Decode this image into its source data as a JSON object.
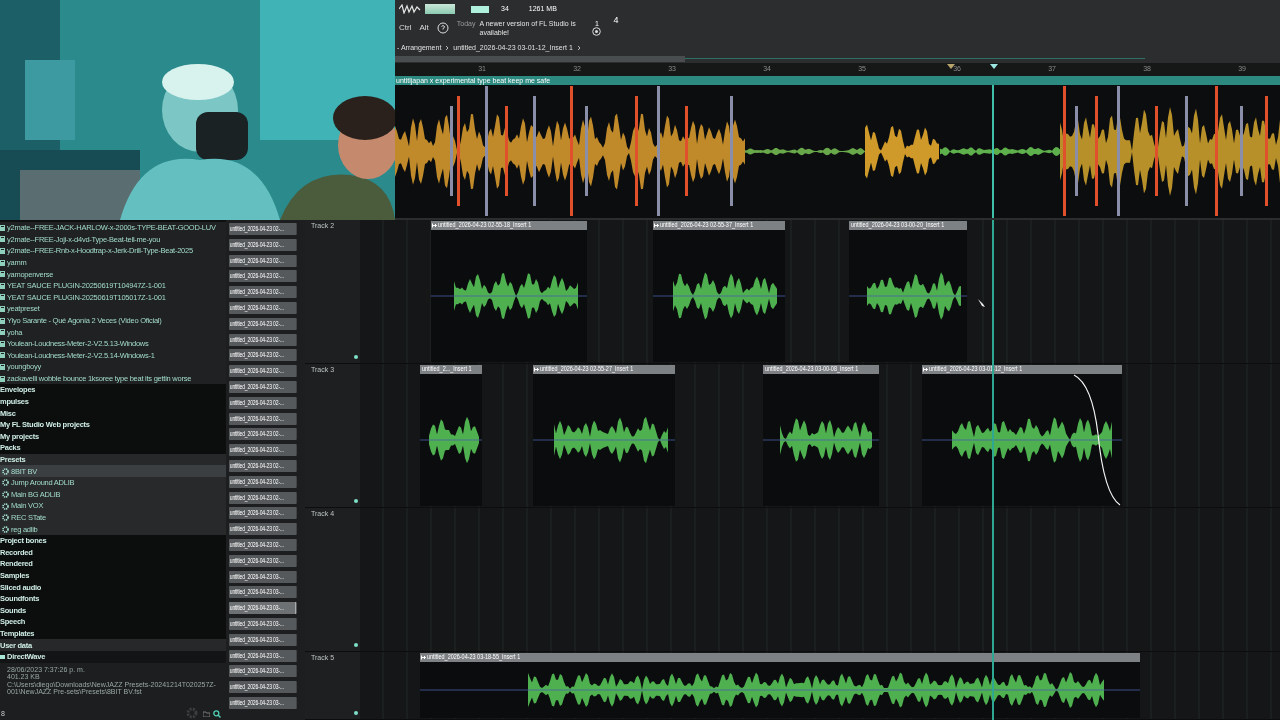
{
  "toolbar": {
    "cpu": "34",
    "memory": "1261 MB",
    "voices": "4",
    "keys": [
      "Ctrl",
      "Alt"
    ],
    "hint_day": "Today",
    "hint": "A newer version of FL Studio is available!",
    "hint_count": "1"
  },
  "breadcrumb": [
    "- Arrangement",
    "untitled_2026-04-23 03-01-12_Insert 1"
  ],
  "ruler": [
    "31",
    "32",
    "33",
    "34",
    "35",
    "36",
    "37",
    "38",
    "39"
  ],
  "browser": {
    "items": [
      {
        "label": "y2mate--FREE-JACK-HARLOW-x-2000s-TYPE-BEAT-GOOD-LUV",
        "kind": "file",
        "selected": false
      },
      {
        "label": "y2mate--FREE-Joji-x-d4vd-Type-Beat-tell-me-you",
        "kind": "file",
        "selected": false
      },
      {
        "label": "y2mate--FREE-Rnb-x-Hoodtrap-x-Jerk-Drill-Type-Beat-2025",
        "kind": "file",
        "selected": false
      },
      {
        "label": "yamm",
        "kind": "file",
        "selected": false
      },
      {
        "label": "yamopenverse",
        "kind": "file",
        "selected": false
      },
      {
        "label": "YEAT SAUCE PLUGIN-20250619T104947Z-1-001",
        "kind": "file",
        "selected": false
      },
      {
        "label": "YEAT SAUCE PLUGIN-20250619T105017Z-1-001",
        "kind": "file",
        "selected": false
      },
      {
        "label": "yeatpreset",
        "kind": "file",
        "selected": false
      },
      {
        "label": "Yiyo Sarante -  Qué Agonía  2 Veces (Video Oficial)",
        "kind": "file",
        "selected": false
      },
      {
        "label": "yoha",
        "kind": "file",
        "selected": false
      },
      {
        "label": "Youlean-Loudness-Meter-2-V2.5.13-Windows",
        "kind": "file",
        "selected": false
      },
      {
        "label": "Youlean-Loudness-Meter-2-V2.5.14-Windows-1",
        "kind": "file",
        "selected": false
      },
      {
        "label": "youngboyy",
        "kind": "file",
        "selected": false
      },
      {
        "label": "zackavelli  wobble  bounce  1ksoree type beat its gettin worse",
        "kind": "file",
        "selected": false
      },
      {
        "label": "Envelopes",
        "kind": "folder",
        "selected": false
      },
      {
        "label": "mpulses",
        "kind": "folder",
        "selected": false
      },
      {
        "label": "Misc",
        "kind": "folder",
        "selected": false
      },
      {
        "label": "My FL Studio Web projects",
        "kind": "folder",
        "selected": false
      },
      {
        "label": "My projects",
        "kind": "folder",
        "selected": false
      },
      {
        "label": "Packs",
        "kind": "folder",
        "selected": false
      },
      {
        "label": "Presets",
        "kind": "heading",
        "selected": false
      },
      {
        "label": "8BIT BV",
        "kind": "preset",
        "selected": true
      },
      {
        "label": "Jump Around ADLIB",
        "kind": "preset",
        "selected": false
      },
      {
        "label": "Main BG ADLIB",
        "kind": "preset",
        "selected": false
      },
      {
        "label": "Main VOX",
        "kind": "preset",
        "selected": false
      },
      {
        "label": "REC STate",
        "kind": "preset",
        "selected": false
      },
      {
        "label": "reg adlib",
        "kind": "preset",
        "selected": false
      },
      {
        "label": "Project bones",
        "kind": "folder",
        "selected": false
      },
      {
        "label": "Recorded",
        "kind": "folder",
        "selected": false
      },
      {
        "label": "Rendered",
        "kind": "folder",
        "selected": false
      },
      {
        "label": "Samples",
        "kind": "folder",
        "selected": false
      },
      {
        "label": "Sliced audio",
        "kind": "folder",
        "selected": false
      },
      {
        "label": "Soundfonts",
        "kind": "folder",
        "selected": false
      },
      {
        "label": "Sounds",
        "kind": "folder",
        "selected": false
      },
      {
        "label": "Speech",
        "kind": "folder",
        "selected": false
      },
      {
        "label": "Templates",
        "kind": "folder",
        "selected": false
      },
      {
        "label": "User data",
        "kind": "heading",
        "selected": false
      },
      {
        "label": "DirectWave",
        "kind": "subfolder",
        "selected": false
      }
    ],
    "info": [
      "28/06/2023 7:37:26 p. m.",
      "401.23 KB",
      "C:\\Users\\diego\\Downloads\\NewJAZZ Presets-20241214T020257Z-001\\NewJAZZ Pre-sets\\Presets\\8BIT BV.fst"
    ],
    "footer": "8"
  },
  "picker": [
    {
      "label": "untitled_2026-04-23 02-...",
      "selected": false
    },
    {
      "label": "untitled_2026-04-23 02-...",
      "selected": false
    },
    {
      "label": "untitled_2026-04-23 02-...",
      "selected": false
    },
    {
      "label": "untitled_2026-04-23 02-...",
      "selected": false
    },
    {
      "label": "untitled_2026-04-23 02-...",
      "selected": false
    },
    {
      "label": "untitled_2026-04-23 02-...",
      "selected": false
    },
    {
      "label": "untitled_2026-04-23 02-...",
      "selected": false
    },
    {
      "label": "untitled_2026-04-23 02-...",
      "selected": false
    },
    {
      "label": "untitled_2026-04-23 02-...",
      "selected": false
    },
    {
      "label": "untitled_2026-04-23 02-...",
      "selected": false
    },
    {
      "label": "untitled_2026-04-23 02-...",
      "selected": false
    },
    {
      "label": "untitled_2026-04-23 02-...",
      "selected": false
    },
    {
      "label": "untitled_2026-04-23 02-...",
      "selected": false
    },
    {
      "label": "untitled_2026-04-23 02-...",
      "selected": false
    },
    {
      "label": "untitled_2026-04-23 02-...",
      "selected": false
    },
    {
      "label": "untitled_2026-04-23 02-...",
      "selected": false
    },
    {
      "label": "untitled_2026-04-23 02-...",
      "selected": false
    },
    {
      "label": "untitled_2026-04-23 02-...",
      "selected": false
    },
    {
      "label": "untitled_2026-04-23 02-...",
      "selected": false
    },
    {
      "label": "untitled_2026-04-23 02-...",
      "selected": false
    },
    {
      "label": "untitled_2026-04-23 02-...",
      "selected": false
    },
    {
      "label": "untitled_2026-04-23 02-...",
      "selected": false
    },
    {
      "label": "untitled_2026-04-23 03-...",
      "selected": false
    },
    {
      "label": "untitled_2026-04-23 03-...",
      "selected": false
    },
    {
      "label": "untitled_2026-04-23 03-...",
      "selected": true
    },
    {
      "label": "untitled_2026-04-23 03-...",
      "selected": false
    },
    {
      "label": "untitled_2026-04-23 03-...",
      "selected": false
    },
    {
      "label": "untitled_2026-04-23 03-...",
      "selected": false
    },
    {
      "label": "untitled_2026-04-23 03-...",
      "selected": false
    },
    {
      "label": "untitled_2026-04-23 03-...",
      "selected": false
    },
    {
      "label": "untitled_2026-04-23 03-...",
      "selected": false
    }
  ],
  "top_clip": {
    "label": "untitljapan x experimental type beat keep me safe"
  },
  "tracks": [
    {
      "name": "Track 2",
      "clips": [
        {
          "label": "untitled_2026-04-23 02-55-18_Insert 1"
        },
        {
          "label": "untitled_2026-04-23 02-55-37_Insert 1"
        },
        {
          "label": "untitled_2026-04-23 03-00-20_Insert 1"
        }
      ]
    },
    {
      "name": "Track 3",
      "clips": [
        {
          "label": "untitled_2..._Insert 1"
        },
        {
          "label": "untitled_2026-04-23 02-55-27_Insert 1"
        },
        {
          "label": "untitled_2026-04-23 03-00-08_Insert 1"
        },
        {
          "label": "untitled_2026-04-23 03-01-12_Insert 1",
          "fade": true
        }
      ]
    },
    {
      "name": "Track 4"
    },
    {
      "name": "Track 5",
      "clips": [
        {
          "label": "untitled_2026-04-23 03-18-55_Insert 1"
        }
      ]
    }
  ]
}
